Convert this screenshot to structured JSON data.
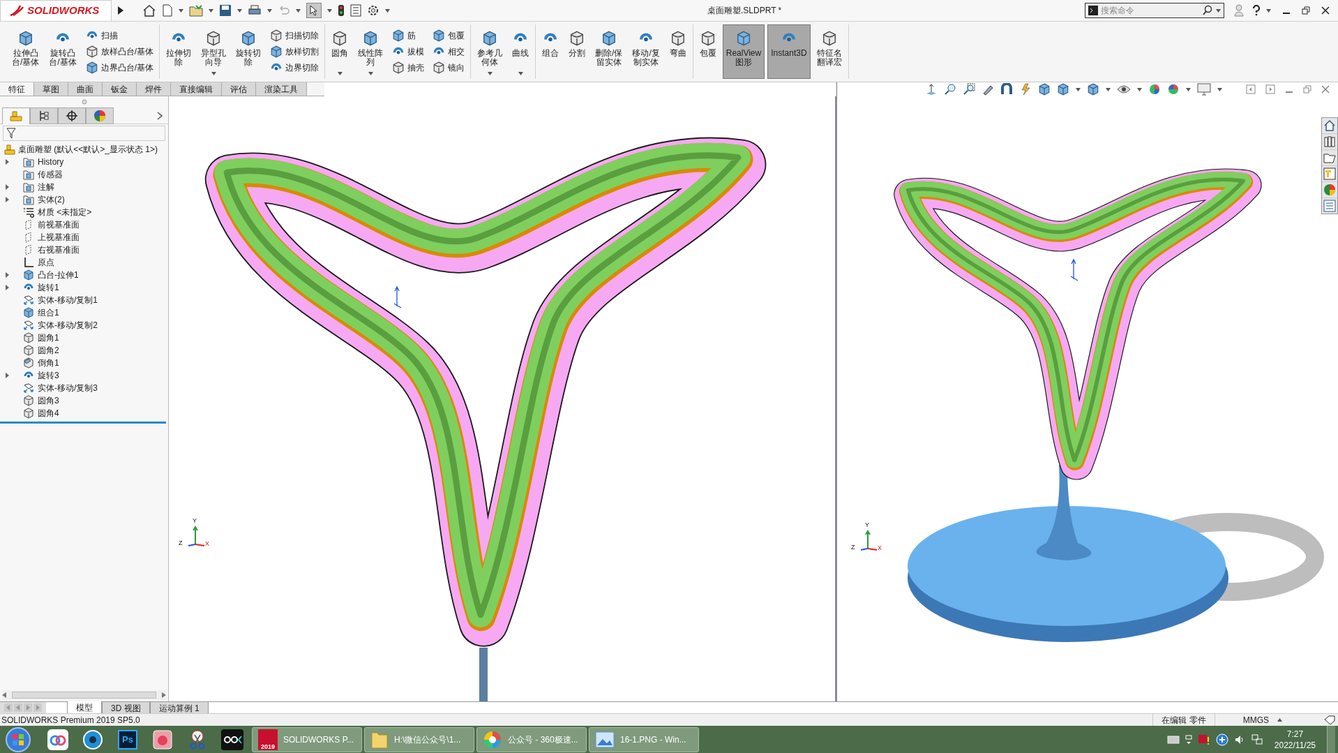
{
  "title_bar": {
    "logo": "SOLIDWORKS",
    "file_title": "桌面雕塑.SLDPRT *",
    "search": {
      "placeholder": "搜索命令"
    }
  },
  "ribbon": {
    "groups": [
      {
        "buttons": [
          {
            "lines": [
              "拉伸凸",
              "台/基体"
            ],
            "dropdown": false,
            "pressed": false
          },
          {
            "lines": [
              "旋转凸",
              "台/基体"
            ],
            "dropdown": false,
            "pressed": false
          }
        ],
        "stacks": [
          [
            "扫描",
            "放样凸台/基体",
            "边界凸台/基体"
          ]
        ]
      },
      {
        "buttons": [
          {
            "lines": [
              "拉伸切",
              "除"
            ],
            "dropdown": false,
            "pressed": false
          },
          {
            "lines": [
              "异型孔",
              "向导"
            ],
            "dropdown": true,
            "pressed": false
          },
          {
            "lines": [
              "旋转切",
              "除"
            ],
            "dropdown": false,
            "pressed": false
          }
        ],
        "stacks": [
          [
            "扫描切除",
            "放样切割",
            "边界切除"
          ]
        ]
      },
      {
        "buttons": [
          {
            "lines": [
              "圆角"
            ],
            "dropdown": true,
            "pressed": false
          },
          {
            "lines": [
              "线性阵",
              "列"
            ],
            "dropdown": true,
            "pressed": false
          }
        ],
        "stacks": [
          [
            "筋",
            "拔模",
            "抽壳"
          ],
          [
            "包覆",
            "相交",
            "镜向"
          ]
        ]
      },
      {
        "buttons": [
          {
            "lines": [
              "参考几",
              "何体"
            ],
            "dropdown": true,
            "pressed": false
          },
          {
            "lines": [
              "曲线"
            ],
            "dropdown": true,
            "pressed": false
          }
        ]
      },
      {
        "buttons": [
          {
            "lines": [
              "组合"
            ],
            "dropdown": false,
            "pressed": false
          },
          {
            "lines": [
              "分割"
            ],
            "dropdown": false,
            "pressed": false
          },
          {
            "lines": [
              "删除/保",
              "留实体"
            ],
            "dropdown": false,
            "pressed": false
          },
          {
            "lines": [
              "移动/复",
              "制实体"
            ],
            "dropdown": false,
            "pressed": false
          },
          {
            "lines": [
              "弯曲"
            ],
            "dropdown": false,
            "pressed": false
          }
        ]
      },
      {
        "buttons": [
          {
            "lines": [
              "包覆"
            ],
            "dropdown": false,
            "pressed": false
          },
          {
            "lines": [
              "RealView",
              "图形"
            ],
            "dropdown": false,
            "pressed": true
          },
          {
            "lines": [
              "Instant3D"
            ],
            "dropdown": false,
            "pressed": true
          },
          {
            "lines": [
              "特征名",
              "翻译宏"
            ],
            "dropdown": false,
            "pressed": false
          }
        ]
      }
    ]
  },
  "tabs": [
    {
      "label": "特征",
      "selected": true
    },
    {
      "label": "草图",
      "selected": false
    },
    {
      "label": "曲面",
      "selected": false
    },
    {
      "label": "钣金",
      "selected": false
    },
    {
      "label": "焊件",
      "selected": false
    },
    {
      "label": "直接编辑",
      "selected": false
    },
    {
      "label": "评估",
      "selected": false
    },
    {
      "label": "渲染工具",
      "selected": false
    }
  ],
  "feature_tree": {
    "panel_tabs": [
      {
        "selected": true
      },
      {
        "selected": false
      },
      {
        "selected": false
      },
      {
        "selected": false
      }
    ],
    "root": "桌面雕塑  (默认<<默认>_显示状态 1>)",
    "items": [
      {
        "label": "History",
        "kind": "folder",
        "expandable": true
      },
      {
        "label": "传感器",
        "kind": "folder",
        "expandable": false
      },
      {
        "label": "注解",
        "kind": "folder",
        "expandable": true
      },
      {
        "label": "实体(2)",
        "kind": "folder",
        "expandable": true
      },
      {
        "label": "材质 <未指定>",
        "kind": "material",
        "expandable": false
      },
      {
        "label": "前视基准面",
        "kind": "plane",
        "expandable": false
      },
      {
        "label": "上视基准面",
        "kind": "plane",
        "expandable": false
      },
      {
        "label": "右视基准面",
        "kind": "plane",
        "expandable": false
      },
      {
        "label": "原点",
        "kind": "origin",
        "expandable": false
      },
      {
        "label": "凸台-拉伸1",
        "kind": "extrude",
        "expandable": true
      },
      {
        "label": "旋转1",
        "kind": "revolve",
        "expandable": true
      },
      {
        "label": "实体-移动/复制1",
        "kind": "move",
        "expandable": false
      },
      {
        "label": "组合1",
        "kind": "combine",
        "expandable": false
      },
      {
        "label": "实体-移动/复制2",
        "kind": "move",
        "expandable": false
      },
      {
        "label": "圆角1",
        "kind": "fillet",
        "expandable": false
      },
      {
        "label": "圆角2",
        "kind": "fillet",
        "expandable": false
      },
      {
        "label": "倒角1",
        "kind": "chamfer",
        "expandable": false
      },
      {
        "label": "旋转3",
        "kind": "revolve",
        "expandable": true
      },
      {
        "label": "实体-移动/复制3",
        "kind": "move",
        "expandable": false
      },
      {
        "label": "圆角3",
        "kind": "fillet",
        "expandable": false
      },
      {
        "label": "圆角4",
        "kind": "fillet",
        "expandable": false
      }
    ]
  },
  "views": [
    {
      "triad": [
        "Y",
        "Z",
        "X"
      ]
    },
    {
      "triad": [
        "Y",
        "Z",
        "X"
      ]
    }
  ],
  "sheet_tabs": [
    {
      "label": "模型",
      "selected": true
    },
    {
      "label": "3D 视图",
      "selected": false
    },
    {
      "label": "运动算例 1",
      "selected": false
    }
  ],
  "status_bar": {
    "product": "SOLIDWORKS Premium 2019 SP5.0",
    "mode": "在编辑 零件",
    "units": "MMGS"
  },
  "taskbar": {
    "pinned": [
      {
        "kind": "cloud"
      },
      {
        "kind": "aperture"
      },
      {
        "kind": "ps",
        "text": "Ps"
      },
      {
        "kind": "app"
      },
      {
        "kind": "scissors"
      },
      {
        "kind": "media"
      }
    ],
    "windows": [
      {
        "kind": "solidworks",
        "label": "SOLIDWORKS P...",
        "badge": "2019"
      },
      {
        "kind": "folder",
        "label": "H:\\微信公众号\\1..."
      },
      {
        "kind": "browser",
        "label": "公众号 - 360极速..."
      },
      {
        "kind": "viewer",
        "label": "16-1.PNG - Win..."
      }
    ],
    "tray": {
      "time": "7:27",
      "date": "2022/11/25"
    }
  }
}
